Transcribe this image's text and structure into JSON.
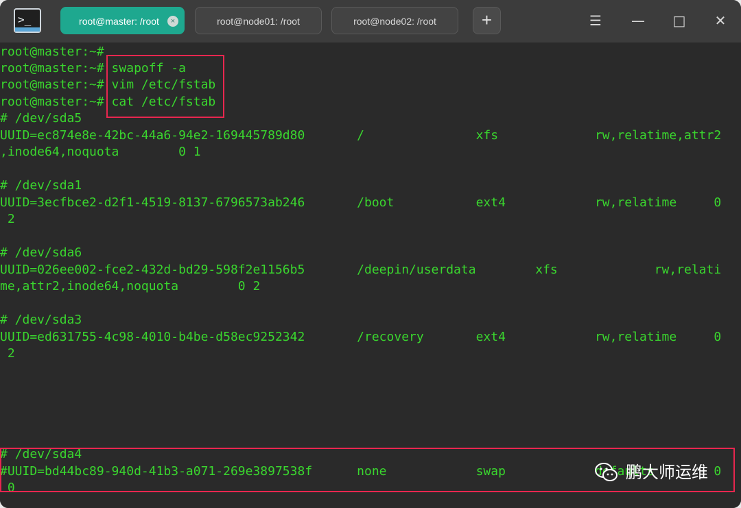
{
  "titlebar": {
    "app_icon": "terminal-icon",
    "tabs": [
      {
        "label": "root@master: /root",
        "active": true
      },
      {
        "label": "root@node01: /root",
        "active": false
      },
      {
        "label": "root@node02: /root",
        "active": false
      }
    ],
    "close_tab_glyph": "×",
    "new_tab_glyph": "+",
    "menu_glyph": "☰",
    "minimize_glyph": "—",
    "maximize_glyph": "□",
    "close_glyph": "✕"
  },
  "terminal": {
    "text_color": "#3ad62e",
    "background": "#2a2a2a",
    "highlight_color": "#e8264f",
    "lines": [
      "root@master:~#",
      "root@master:~# swapoff -a",
      "root@master:~# vim /etc/fstab",
      "root@master:~# cat /etc/fstab",
      "# /dev/sda5",
      "UUID=ec874e8e-42bc-44a6-94e2-169445789d80       /               xfs             rw,relatime,attr2",
      ",inode64,noquota        0 1",
      "",
      "# /dev/sda1",
      "UUID=3ecfbce2-d2f1-4519-8137-6796573ab246       /boot           ext4            rw,relatime     0",
      " 2",
      "",
      "# /dev/sda6",
      "UUID=026ee002-fce2-432d-bd29-598f2e1156b5       /deepin/userdata        xfs             rw,relati",
      "me,attr2,inode64,noquota        0 2",
      "",
      "# /dev/sda3",
      "UUID=ed631755-4c98-4010-b4be-d58ec9252342       /recovery       ext4            rw,relatime     0",
      " 2",
      "",
      "",
      "",
      "",
      "# /dev/sda4",
      "#UUID=bd44bc89-940d-41b3-a071-269e3897538f      none            swap            defaults        0",
      " 0"
    ]
  },
  "watermark": {
    "icon": "wechat-icon",
    "text": "鹏大师运维"
  }
}
